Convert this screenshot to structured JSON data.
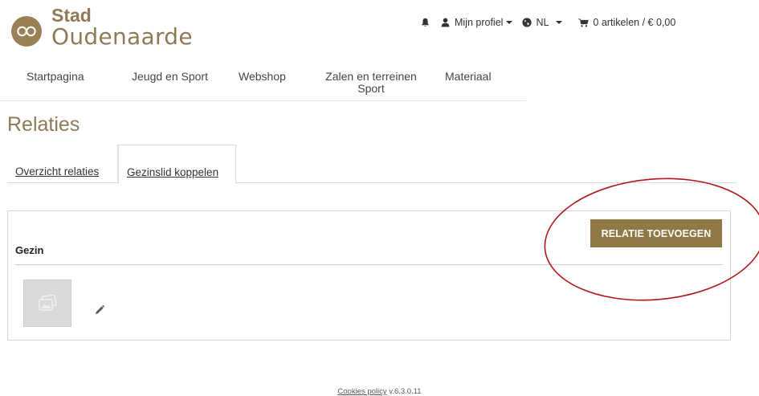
{
  "header": {
    "logo_line1": "Stad",
    "logo_line2": "Oudenaarde",
    "profile_label": "Mijn profiel",
    "language": "NL",
    "cart_label": "0 artikelen / € 0,00"
  },
  "nav": {
    "items": [
      {
        "label": "Startpagina"
      },
      {
        "label": "Jeugd en Sport"
      },
      {
        "label": "Webshop"
      },
      {
        "label": "Zalen en terreinen Sport"
      },
      {
        "label": "Materiaal"
      }
    ]
  },
  "page": {
    "title": "Relaties"
  },
  "tabs": [
    {
      "label": "Overzicht relaties"
    },
    {
      "label": "Gezinslid koppelen"
    }
  ],
  "panel": {
    "add_button": "RELATIE TOEVOEGEN",
    "section_title": "Gezin"
  },
  "footer": {
    "cookies_link": "Cookies policy",
    "version": " v.6.3.0.11"
  },
  "colors": {
    "brand": "#8f7a55",
    "button": "#8f7a45",
    "annotation": "#b01818"
  }
}
